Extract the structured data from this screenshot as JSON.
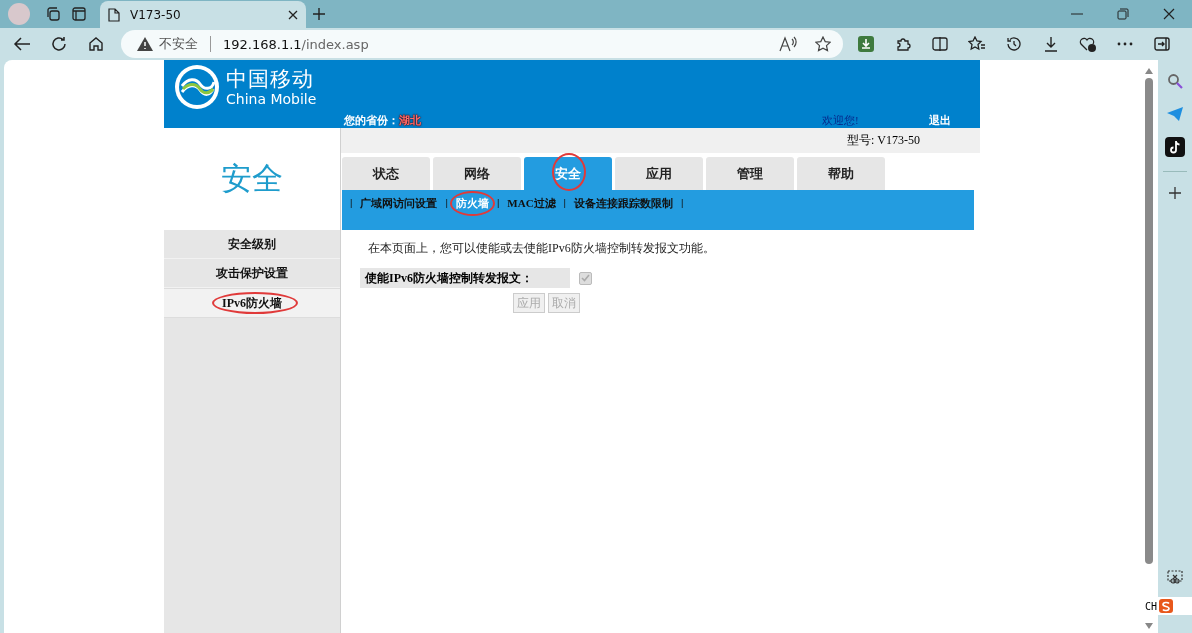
{
  "browser": {
    "tab": {
      "title": "V173-50",
      "selected": true
    },
    "security": "不安全",
    "url_host": "192.168.1.1",
    "url_path": "/index.asp"
  },
  "header": {
    "brand_cn": "中国移动",
    "brand_en": "China Mobile",
    "province_label": "您的省份：",
    "province": "湖北",
    "welcome": "欢迎您!",
    "logout": "退出"
  },
  "model": "型号: V173-50",
  "section_title": "安全",
  "side_menu": [
    {
      "label": "安全级别",
      "selected": false,
      "circled": false
    },
    {
      "label": "攻击保护设置",
      "selected": false,
      "circled": false
    },
    {
      "label": "IPv6防火墙",
      "selected": true,
      "circled": true
    }
  ],
  "tabs": [
    {
      "label": "状态",
      "selected": false,
      "circled": false
    },
    {
      "label": "网络",
      "selected": false,
      "circled": false
    },
    {
      "label": "安全",
      "selected": true,
      "circled": true
    },
    {
      "label": "应用",
      "selected": false,
      "circled": false
    },
    {
      "label": "管理",
      "selected": false,
      "circled": false
    },
    {
      "label": "帮助",
      "selected": false,
      "circled": false
    }
  ],
  "subnav": [
    {
      "kind": "separator",
      "text": "|"
    },
    {
      "kind": "link",
      "text": "广域网访问设置",
      "selected": false,
      "circled": false
    },
    {
      "kind": "separator",
      "text": "|"
    },
    {
      "kind": "link",
      "text": "防火墙",
      "selected": true,
      "circled": true
    },
    {
      "kind": "separator",
      "text": "|"
    },
    {
      "kind": "link",
      "text": "MAC过滤",
      "selected": false,
      "circled": false
    },
    {
      "kind": "separator",
      "text": "|"
    },
    {
      "kind": "link",
      "text": "设备连接跟踪数限制",
      "selected": false,
      "circled": false
    },
    {
      "kind": "separator",
      "text": "|"
    }
  ],
  "description": "在本页面上，您可以使能或去使能IPv6防火墙控制转发报文功能。",
  "form": {
    "label": "使能IPv6防火墙控制转发报文：",
    "checked": true,
    "disabled": true
  },
  "buttons": [
    {
      "label": "应用",
      "disabled": true
    },
    {
      "label": "取消",
      "disabled": true
    }
  ],
  "ime": {
    "language": "CH"
  }
}
